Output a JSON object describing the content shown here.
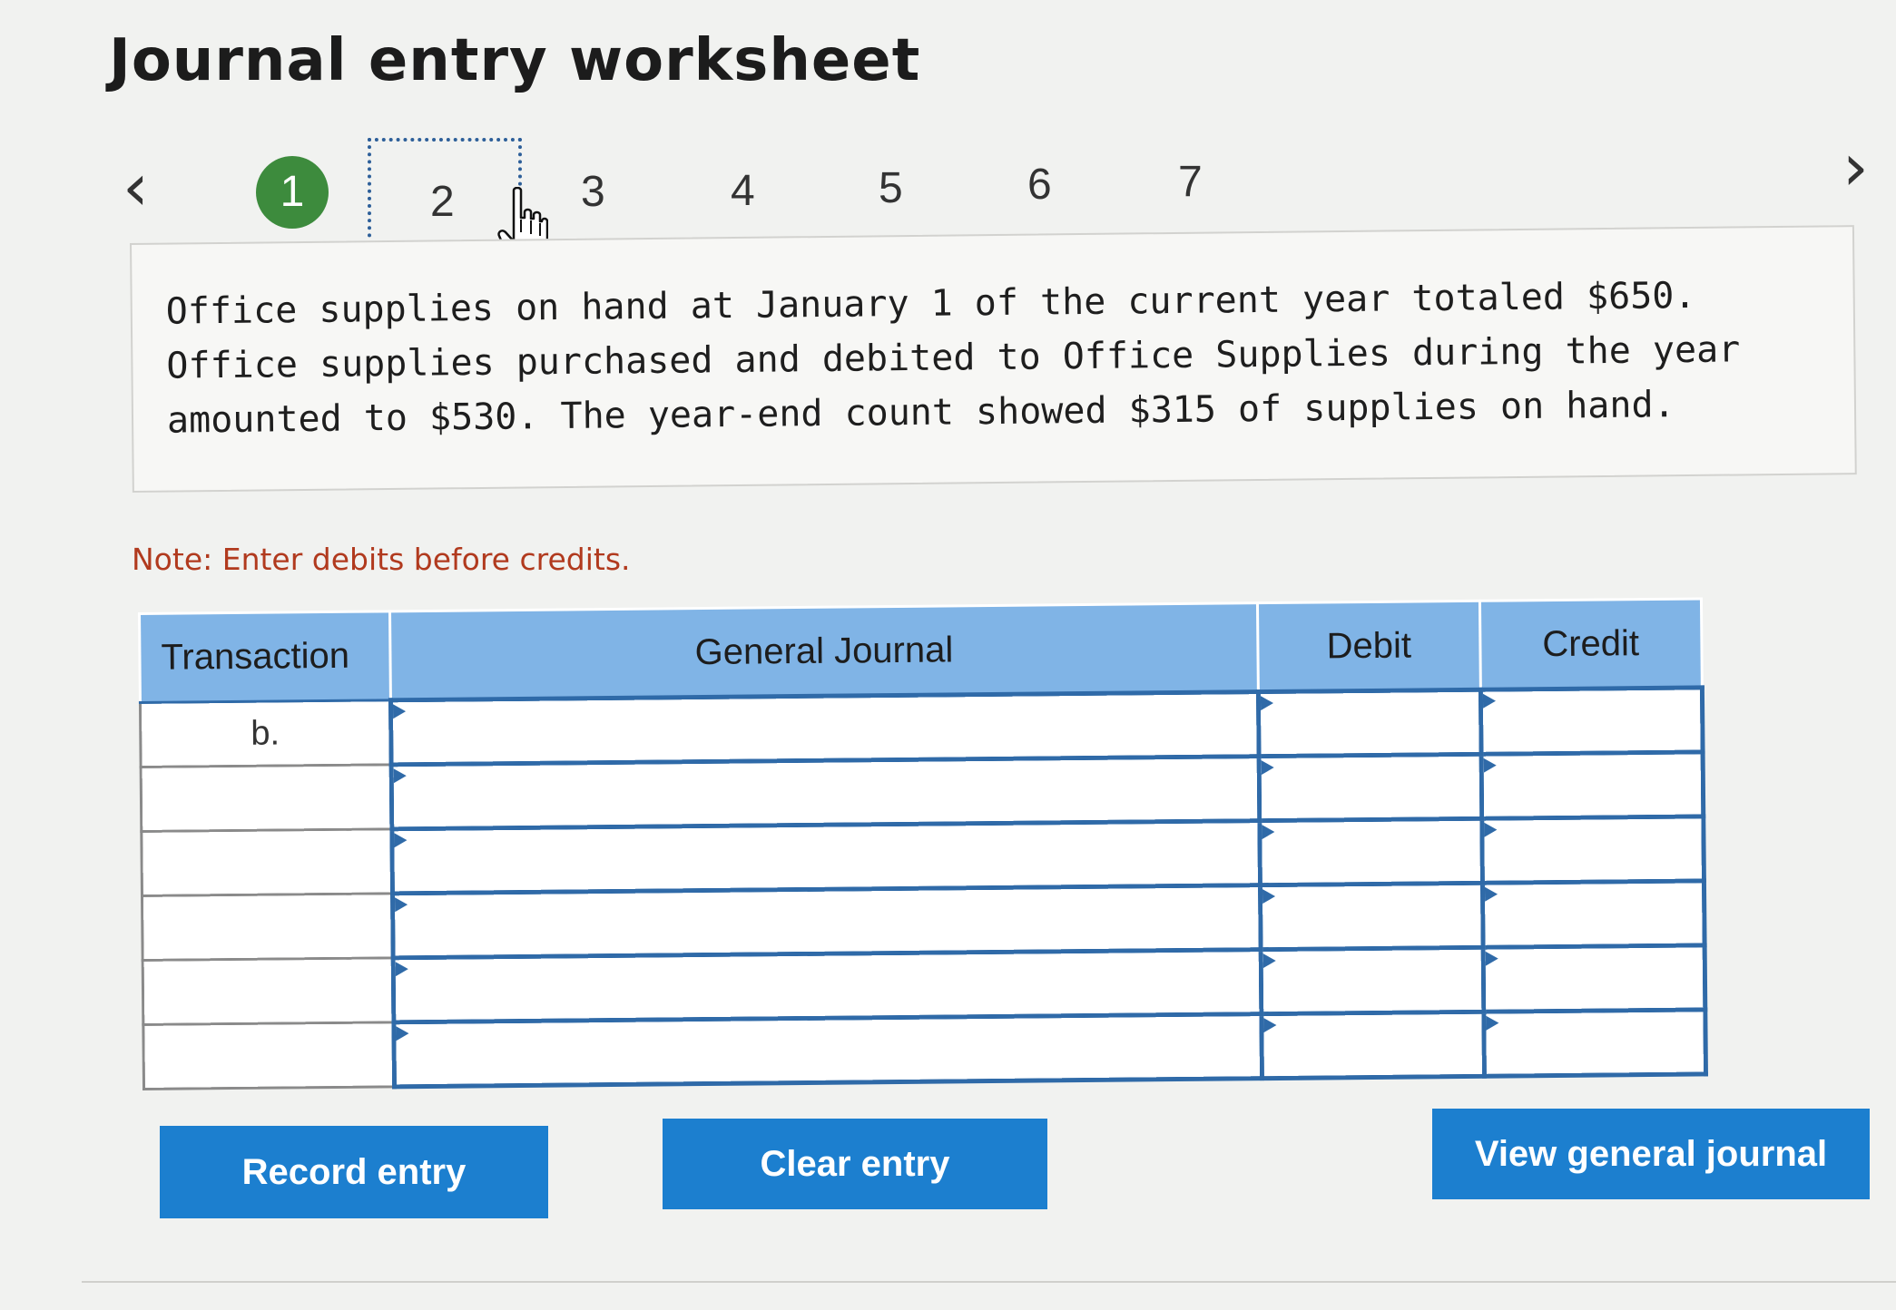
{
  "title": "Journal entry worksheet",
  "pagination": {
    "prev_icon": "chevron-left-icon",
    "next_icon": "chevron-right-icon",
    "prev_glyph": "‹",
    "next_glyph": "›",
    "steps": [
      "1",
      "2",
      "3",
      "4",
      "5",
      "6",
      "7"
    ],
    "completed_step": "1",
    "current_step": "2"
  },
  "problem": {
    "text": "Office supplies on hand at January 1 of the current year totaled $650. Office supplies purchased and debited to Office Supplies during the year amounted to $530. The year-end count showed $315 of supplies on hand."
  },
  "note": "Note: Enter debits before credits.",
  "table": {
    "headers": {
      "transaction": "Transaction",
      "journal": "General Journal",
      "debit": "Debit",
      "credit": "Credit"
    },
    "rows": [
      {
        "transaction": "b.",
        "account": "",
        "debit": "",
        "credit": ""
      },
      {
        "transaction": "",
        "account": "",
        "debit": "",
        "credit": ""
      },
      {
        "transaction": "",
        "account": "",
        "debit": "",
        "credit": ""
      },
      {
        "transaction": "",
        "account": "",
        "debit": "",
        "credit": ""
      },
      {
        "transaction": "",
        "account": "",
        "debit": "",
        "credit": ""
      },
      {
        "transaction": "",
        "account": "",
        "debit": "",
        "credit": ""
      }
    ]
  },
  "buttons": {
    "record": "Record entry",
    "clear": "Clear entry",
    "view": "View general journal"
  },
  "colors": {
    "header_bg": "#80b4e6",
    "button_bg": "#1c7fcf",
    "completed_step": "#3d8b3d",
    "note_text": "#b13a1e",
    "input_border": "#2f6aa8"
  }
}
